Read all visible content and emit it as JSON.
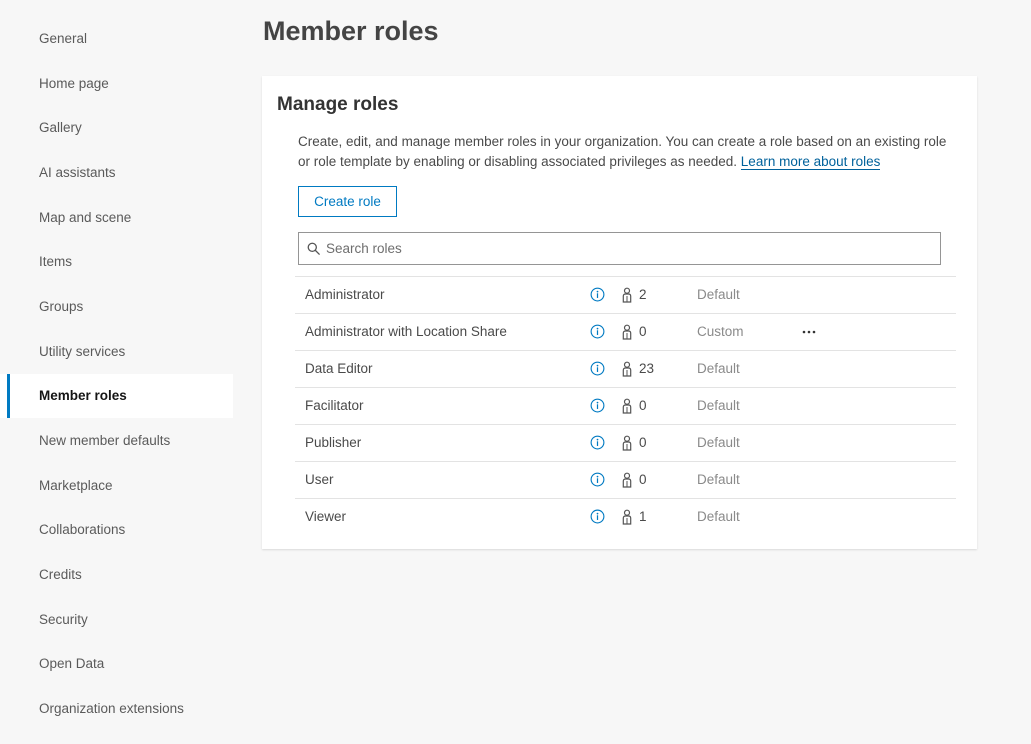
{
  "sidebar": {
    "items": [
      {
        "label": "General"
      },
      {
        "label": "Home page"
      },
      {
        "label": "Gallery"
      },
      {
        "label": "AI assistants"
      },
      {
        "label": "Map and scene"
      },
      {
        "label": "Items"
      },
      {
        "label": "Groups"
      },
      {
        "label": "Utility services"
      },
      {
        "label": "Member roles"
      },
      {
        "label": "New member defaults"
      },
      {
        "label": "Marketplace"
      },
      {
        "label": "Collaborations"
      },
      {
        "label": "Credits"
      },
      {
        "label": "Security"
      },
      {
        "label": "Open Data"
      },
      {
        "label": "Organization extensions"
      }
    ],
    "active_index": 8
  },
  "page": {
    "title": "Member roles"
  },
  "card": {
    "title": "Manage roles",
    "description": "Create, edit, and manage member roles in your organization. You can create a role based on an existing role or role template by enabling or disabling associated privileges as needed.",
    "learn_more_link": "Learn more about roles",
    "create_button": "Create role",
    "search_placeholder": "Search roles"
  },
  "roles": [
    {
      "name": "Administrator",
      "count": "2",
      "type": "Default",
      "has_menu": false
    },
    {
      "name": "Administrator with Location Share",
      "count": "0",
      "type": "Custom",
      "has_menu": true
    },
    {
      "name": "Data Editor",
      "count": "23",
      "type": "Default",
      "has_menu": false
    },
    {
      "name": "Facilitator",
      "count": "0",
      "type": "Default",
      "has_menu": false
    },
    {
      "name": "Publisher",
      "count": "0",
      "type": "Default",
      "has_menu": false
    },
    {
      "name": "User",
      "count": "0",
      "type": "Default",
      "has_menu": false
    },
    {
      "name": "Viewer",
      "count": "1",
      "type": "Default",
      "has_menu": false
    }
  ],
  "icons": {
    "info": "info-icon",
    "members": "user-icon",
    "more": "ellipsis-icon",
    "search": "search-icon"
  },
  "colors": {
    "accent": "#007ac2",
    "link": "#00619b",
    "background": "#f7f7f7"
  }
}
